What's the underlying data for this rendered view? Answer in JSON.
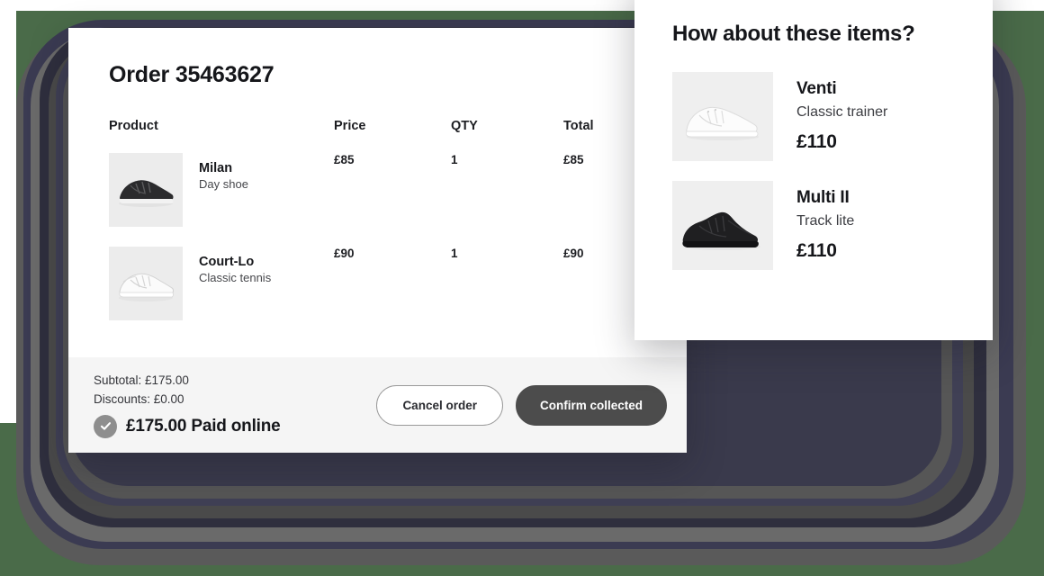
{
  "theme": {
    "page_background": "#4a6b49",
    "card_background": "#ffffff",
    "footer_background": "#f5f5f5",
    "primary_button_color": "#4c4c4c",
    "check_badge_color": "#8e8e8e",
    "thumb_background": "#ececec",
    "ring_colors": [
      "#5a5a5a",
      "#3b3b52",
      "#6a6a6a",
      "#2f2f3e",
      "#4a4a4a",
      "#404055",
      "#565656",
      "#3a3a4c"
    ]
  },
  "order_card": {
    "title": "Order 35463627",
    "table": {
      "headers": [
        "Product",
        "Price",
        "QTY",
        "Total"
      ],
      "rows": [
        {
          "name": "Milan",
          "subtitle": "Day shoe",
          "price": "£85",
          "qty": "1",
          "total": "£85",
          "image": "black-sneaker-thumb"
        },
        {
          "name": "Court-Lo",
          "subtitle": "Classic tennis",
          "price": "£90",
          "qty": "1",
          "total": "£90",
          "image": "white-sneaker-thumb"
        }
      ]
    },
    "footer": {
      "subtotal_label": "Subtotal: £175.00",
      "discounts_label": "Discounts: £0.00",
      "paid_label": "£175.00 Paid online",
      "check_icon": "check-circle-icon",
      "cancel_button": "Cancel order",
      "confirm_button": "Confirm collected"
    }
  },
  "reco_card": {
    "title": "How about these items?",
    "items": [
      {
        "name": "Venti",
        "subtitle": "Classic trainer",
        "price": "£110",
        "image": "white-low-trainer-thumb"
      },
      {
        "name": "Multi II",
        "subtitle": "Track lite",
        "price": "£110",
        "image": "black-track-shoe-thumb"
      }
    ]
  }
}
